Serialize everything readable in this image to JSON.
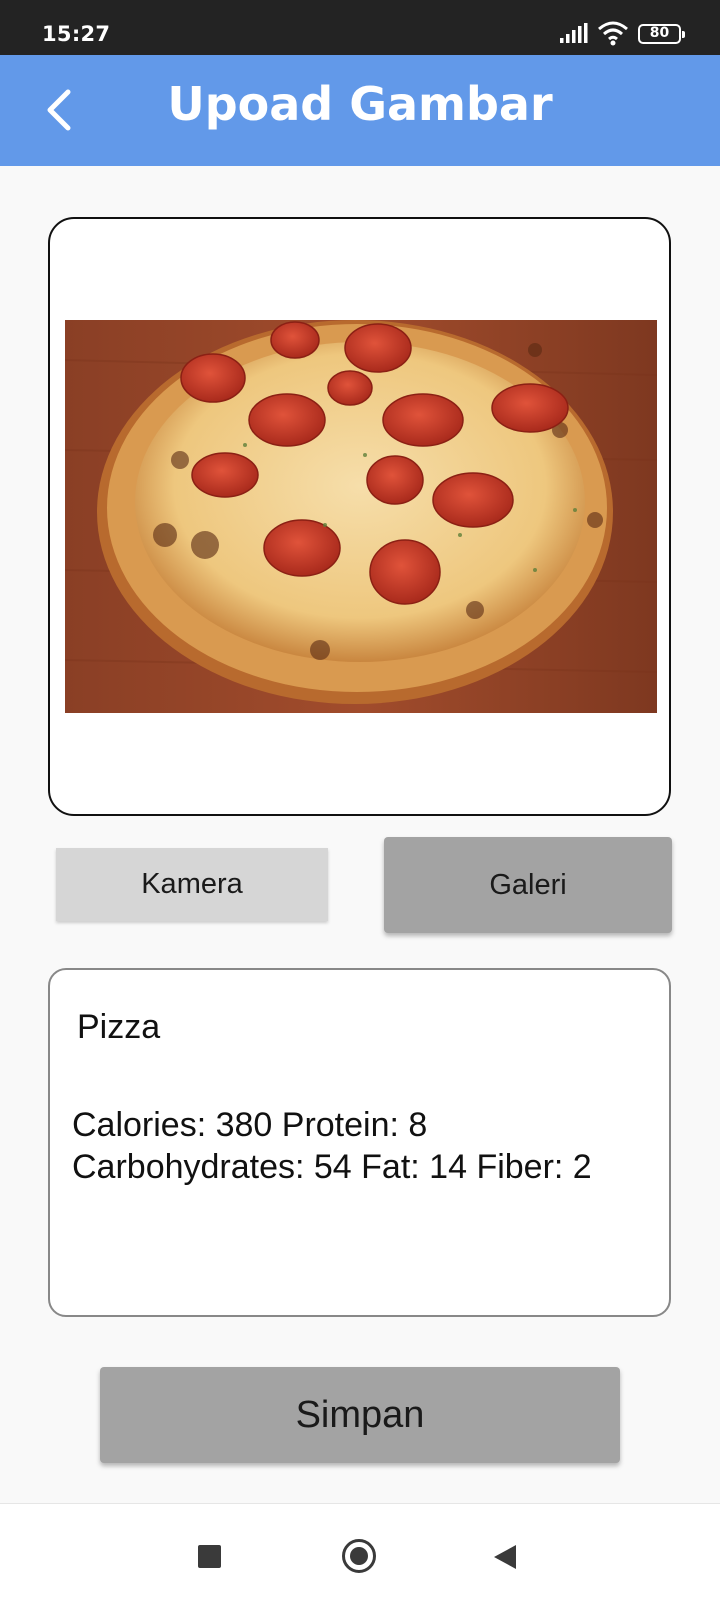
{
  "status_bar": {
    "time": "15:27",
    "battery": "80",
    "icons": [
      "signal-icon",
      "wifi-icon",
      "battery-icon"
    ]
  },
  "app_bar": {
    "title": "Upoad Gambar",
    "back_icon": "chevron-left-icon",
    "background_color": "#6299e9"
  },
  "image_preview": {
    "subject": "pepperoni pizza photo"
  },
  "buttons": {
    "camera_label": "Kamera",
    "gallery_label": "Galeri",
    "save_label": "Simpan"
  },
  "result": {
    "name": "Pizza",
    "nutrition_line1": "Calories: 380 Protein: 8",
    "nutrition_line2": "Carbohydrates: 54 Fat: 14 Fiber: 2"
  },
  "nav_bar": {
    "icons": [
      "recents-icon",
      "home-icon",
      "back-icon"
    ]
  }
}
